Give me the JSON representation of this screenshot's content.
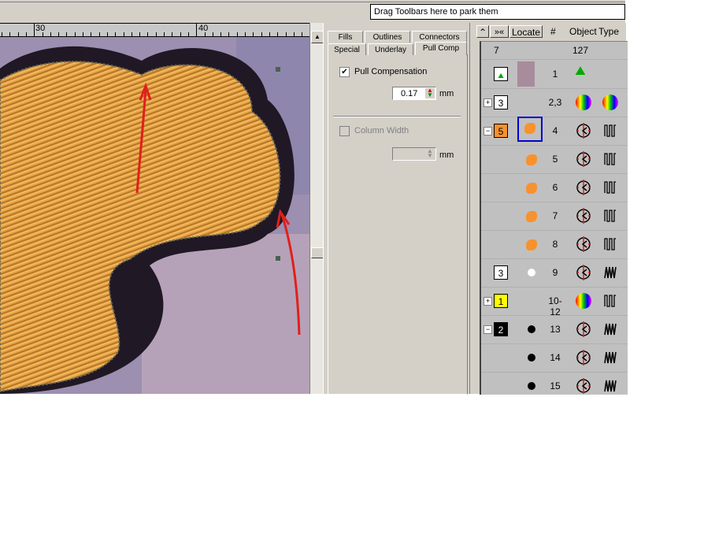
{
  "toolbar": {
    "park_text": "Drag Toolbars here to park them"
  },
  "ruler": {
    "labels": [
      "30",
      "40"
    ]
  },
  "panel": {
    "tabs": [
      "Fills",
      "Outlines",
      "Connectors",
      "Special",
      "Underlay",
      "Pull Comp"
    ],
    "active_tab": "Pull Comp",
    "pull_comp_label": "Pull Compensation",
    "pull_comp_checked": true,
    "pull_comp_value": "0.17",
    "unit": "mm",
    "column_width_label": "Column Width",
    "column_width_checked": false,
    "column_width_value": "",
    "unit2": "mm"
  },
  "list": {
    "buttons": {
      "collapse": "⌃",
      "expand": "»«",
      "locate": "Locate"
    },
    "headers": {
      "num": "#",
      "object": "Object",
      "type": "Type"
    },
    "summary": {
      "col1": "7",
      "col2": "127"
    },
    "rows": [
      {
        "box": "",
        "num": "1",
        "kind": "artwork"
      },
      {
        "box": "3",
        "num": "2,3",
        "kind": "group",
        "expand": "+"
      },
      {
        "box": "5",
        "num": "4",
        "kind": "fill",
        "expand": "−"
      },
      {
        "box": "",
        "num": "5",
        "kind": "fill"
      },
      {
        "box": "",
        "num": "6",
        "kind": "fill"
      },
      {
        "box": "",
        "num": "7",
        "kind": "fill"
      },
      {
        "box": "",
        "num": "8",
        "kind": "fill"
      },
      {
        "box": "3",
        "num": "9",
        "kind": "satin"
      },
      {
        "box": "1",
        "num": "10-12",
        "kind": "group",
        "expand": "+"
      },
      {
        "box": "2",
        "num": "13",
        "kind": "satin",
        "expand": "−"
      },
      {
        "box": "",
        "num": "14",
        "kind": "satin"
      },
      {
        "box": "",
        "num": "15",
        "kind": "satin"
      }
    ]
  },
  "colors": {
    "orange": "#f7922e",
    "yellow": "#ffff00",
    "black": "#000000",
    "white": "#ffffff",
    "arrow": "#e0201c",
    "selection": "#0000d0"
  }
}
